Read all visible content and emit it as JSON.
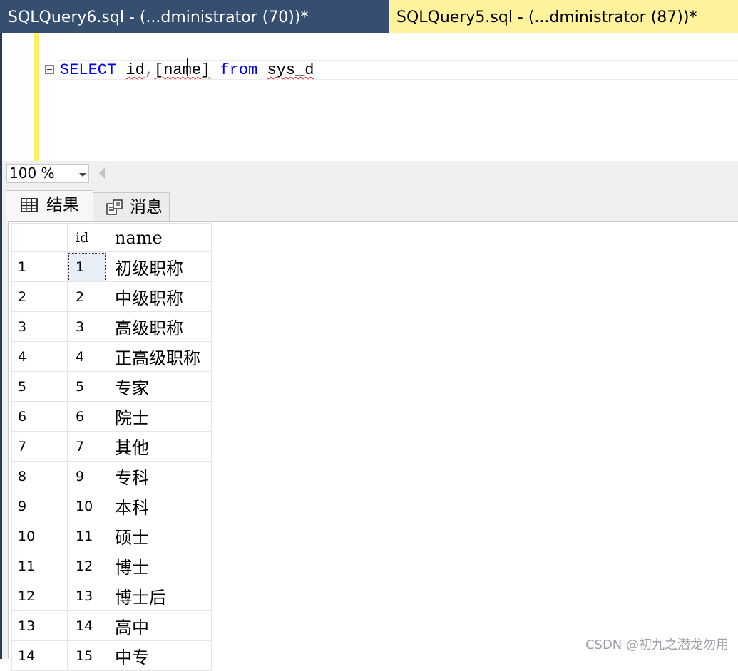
{
  "tabs": [
    {
      "label": "SQLQuery6.sql - (...dministrator (70))*",
      "active": false
    },
    {
      "label": "SQLQuery5.sql - (...dministrator (87))*",
      "active": true
    }
  ],
  "editor": {
    "tokens": {
      "select": "SELECT",
      "id": "id",
      "comma": ",",
      "name": "[name]",
      "from": "from",
      "table": "sys_d"
    }
  },
  "zoom": {
    "value": "100 %"
  },
  "results": {
    "tab_results": "结果",
    "tab_messages": "消息",
    "columns": [
      "",
      "id",
      "name"
    ],
    "rows": [
      {
        "n": "1",
        "id": "1",
        "name": "初级职称"
      },
      {
        "n": "2",
        "id": "2",
        "name": "中级职称"
      },
      {
        "n": "3",
        "id": "3",
        "name": "高级职称"
      },
      {
        "n": "4",
        "id": "4",
        "name": "正高级职称"
      },
      {
        "n": "5",
        "id": "5",
        "name": "专家"
      },
      {
        "n": "6",
        "id": "6",
        "name": "院士"
      },
      {
        "n": "7",
        "id": "7",
        "name": "其他"
      },
      {
        "n": "8",
        "id": "9",
        "name": "专科"
      },
      {
        "n": "9",
        "id": "10",
        "name": "本科"
      },
      {
        "n": "10",
        "id": "11",
        "name": "硕士"
      },
      {
        "n": "11",
        "id": "12",
        "name": "博士"
      },
      {
        "n": "12",
        "id": "13",
        "name": "博士后"
      },
      {
        "n": "13",
        "id": "14",
        "name": "高中"
      },
      {
        "n": "14",
        "id": "15",
        "name": "中专"
      }
    ]
  },
  "watermark": "CSDN @初九之潜龙勿用",
  "colors": {
    "tabstrip": "#293955",
    "active_tab": "#fff29d",
    "keyword": "#0000ff",
    "selection_margin": "#ffee62"
  }
}
